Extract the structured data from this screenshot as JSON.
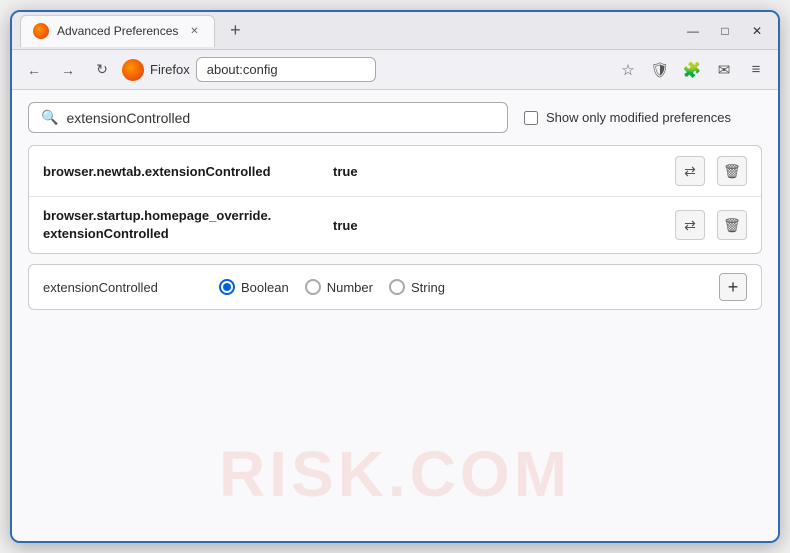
{
  "window": {
    "title": "Advanced Preferences",
    "new_tab_label": "+",
    "close_label": "✕",
    "minimize_label": "—",
    "maximize_label": "□"
  },
  "tab": {
    "label": "Advanced Preferences",
    "close_label": "✕"
  },
  "navbar": {
    "back_label": "←",
    "forward_label": "→",
    "reload_label": "↻",
    "site_name": "Firefox",
    "address": "about:config",
    "bookmark_icon": "☆",
    "pocket_icon": "🛡",
    "extension_icon": "🧩",
    "mail_icon": "✉",
    "more_icon": "≡"
  },
  "search": {
    "value": "extensionControlled",
    "placeholder": "Search preference name",
    "modified_label": "Show only modified preferences"
  },
  "preferences": [
    {
      "name": "browser.newtab.extensionControlled",
      "value": "true"
    },
    {
      "name_line1": "browser.startup.homepage_override.",
      "name_line2": "extensionControlled",
      "value": "true"
    }
  ],
  "new_pref": {
    "name": "extensionControlled",
    "types": [
      {
        "label": "Boolean",
        "selected": true
      },
      {
        "label": "Number",
        "selected": false
      },
      {
        "label": "String",
        "selected": false
      }
    ],
    "add_label": "+"
  },
  "watermark": {
    "text": "RISK.COM"
  },
  "colors": {
    "accent": "#2d6bb5",
    "radio_selected": "#0060df",
    "border": "#ccc"
  }
}
